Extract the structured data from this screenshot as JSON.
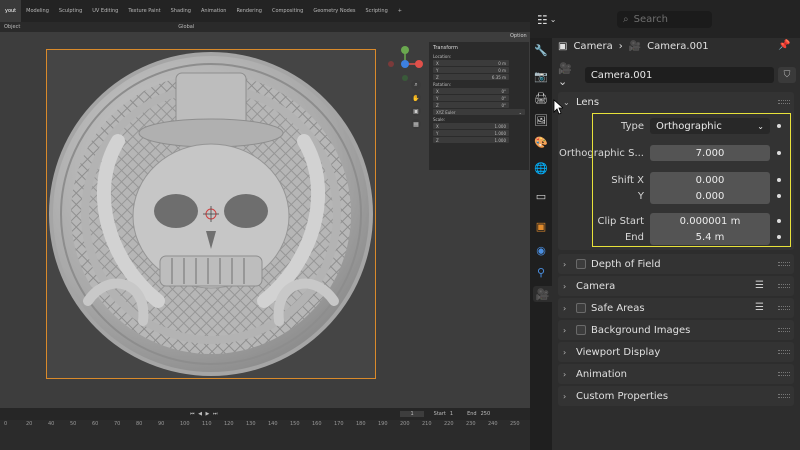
{
  "topbar": {
    "workspaces": [
      "yout",
      "Modeling",
      "Sculpting",
      "UV Editing",
      "Texture Paint",
      "Shading",
      "Animation",
      "Rendering",
      "Compositing",
      "Geometry Nodes",
      "Scripting",
      "+"
    ]
  },
  "viewport_header": {
    "object_label": "Object",
    "orientation": "Global",
    "options": "Option"
  },
  "npanel": {
    "title": "Transform",
    "location_label": "Location:",
    "location": [
      {
        "axis": "X",
        "value": "0 m"
      },
      {
        "axis": "Y",
        "value": "0 m"
      },
      {
        "axis": "Z",
        "value": "6.35 m"
      }
    ],
    "rotation_label": "Rotation:",
    "rotation": [
      {
        "axis": "X",
        "value": "0°"
      },
      {
        "axis": "Y",
        "value": "0°"
      },
      {
        "axis": "Z",
        "value": "0°"
      }
    ],
    "rotation_mode": "XYZ Euler",
    "scale_label": "Scale:",
    "scale": [
      {
        "axis": "X",
        "value": "1.000"
      },
      {
        "axis": "Y",
        "value": "1.000"
      },
      {
        "axis": "Z",
        "value": "1.000"
      }
    ]
  },
  "timeline": {
    "current_frame": "1",
    "start_label": "Start",
    "start": "1",
    "end_label": "End",
    "end": "250",
    "ruler": [
      "0",
      "20",
      "40",
      "50",
      "60",
      "70",
      "80",
      "90",
      "100",
      "110",
      "120",
      "130",
      "140",
      "150",
      "160",
      "170",
      "180",
      "190",
      "200",
      "210",
      "220",
      "230",
      "240",
      "250"
    ]
  },
  "properties": {
    "search_placeholder": "Search",
    "breadcrumb": {
      "object": "Camera",
      "data": "Camera.001"
    },
    "datablock_name": "Camera.001",
    "lens": {
      "title": "Lens",
      "type_label": "Type",
      "type_value": "Orthographic",
      "ortho_scale_label": "Orthographic S...",
      "ortho_scale_value": "7.000",
      "shift_x_label": "Shift X",
      "shift_x_value": "0.000",
      "shift_y_label": "Y",
      "shift_y_value": "0.000",
      "clip_start_label": "Clip Start",
      "clip_start_value": "0.000001 m",
      "clip_end_label": "End",
      "clip_end_value": "5.4 m"
    },
    "panels": {
      "dof": "Depth of Field",
      "camera": "Camera",
      "safe_areas": "Safe Areas",
      "background_images": "Background Images",
      "viewport_display": "Viewport Display",
      "animation": "Animation",
      "custom_properties": "Custom Properties"
    }
  },
  "colors": {
    "highlight": "#e8e23a",
    "camera_frame": "#d98a2b",
    "active_tab": "#2d2d2d"
  }
}
